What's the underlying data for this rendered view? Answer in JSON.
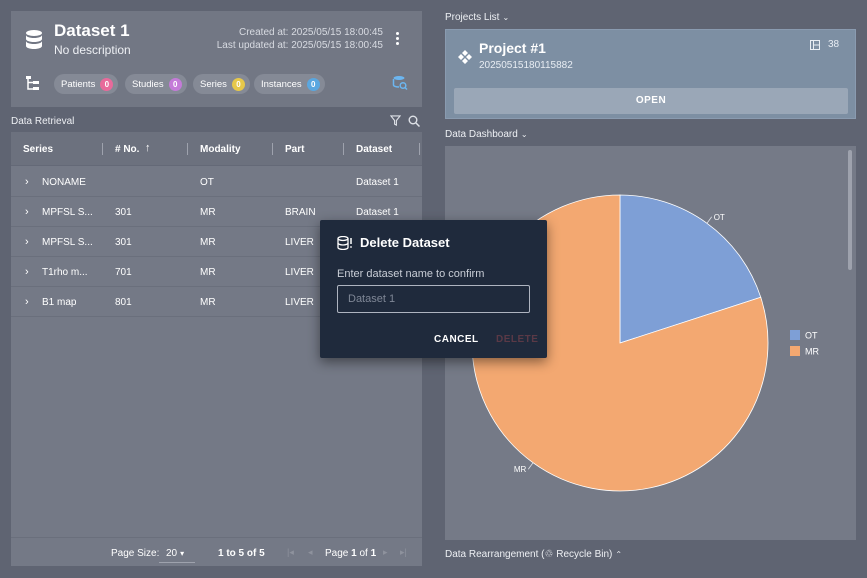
{
  "dataset": {
    "title": "Dataset 1",
    "description": "No description",
    "created": "Created at: 2025/05/15 18:00:45",
    "updated": "Last updated at: 2025/05/15 18:00:45"
  },
  "chips": [
    {
      "label": "Patients",
      "count": "0",
      "color": "#e86a9b"
    },
    {
      "label": "Studies",
      "count": "0",
      "color": "#c47bd8"
    },
    {
      "label": "Series",
      "count": "0",
      "color": "#e6c84a"
    },
    {
      "label": "Instances",
      "count": "0",
      "color": "#5aa7e0"
    }
  ],
  "retrieval": {
    "label": "Data Retrieval",
    "columns": [
      "Series",
      "# No.",
      "Modality",
      "Part",
      "Dataset"
    ],
    "sort_icon": "arrow-up-icon",
    "rows": [
      {
        "series": "NONAME",
        "no": "",
        "modality": "OT",
        "part": "",
        "dataset": "Dataset 1"
      },
      {
        "series": "MPFSL S...",
        "no": "301",
        "modality": "MR",
        "part": "BRAIN",
        "dataset": "Dataset 1"
      },
      {
        "series": "MPFSL S...",
        "no": "301",
        "modality": "MR",
        "part": "LIVER",
        "dataset": ""
      },
      {
        "series": "T1rho m...",
        "no": "701",
        "modality": "MR",
        "part": "LIVER",
        "dataset": ""
      },
      {
        "series": "B1 map",
        "no": "801",
        "modality": "MR",
        "part": "LIVER",
        "dataset": ""
      }
    ]
  },
  "pager": {
    "size_label": "Page Size:",
    "size_value": "20",
    "range": "1 to 5 of 5",
    "page_word": "Page",
    "page_current": "1",
    "page_of": "of",
    "page_total": "1"
  },
  "projects": {
    "label": "Projects List",
    "title": "Project #1",
    "id": "20250515180115882",
    "count": "38",
    "open_label": "OPEN"
  },
  "dashboard": {
    "label": "Data Dashboard"
  },
  "rearrangement": {
    "label": "Data Rearrangement (♲ Recycle Bin)"
  },
  "modal": {
    "title": "Delete Dataset",
    "prompt": "Enter dataset name to confirm",
    "placeholder": "Dataset 1",
    "cancel": "CANCEL",
    "delete": "DELETE"
  },
  "chart_data": {
    "type": "pie",
    "categories": [
      "OT",
      "MR"
    ],
    "values": [
      1,
      4
    ],
    "colors": [
      "#7e9fd6",
      "#f3a871"
    ],
    "legend_placement": "right"
  }
}
